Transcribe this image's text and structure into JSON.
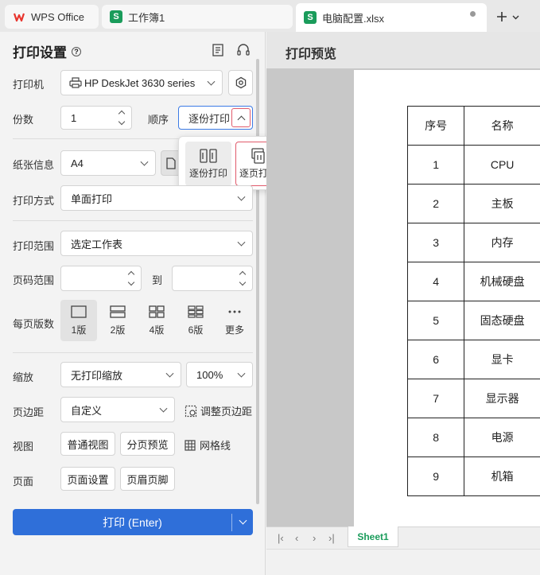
{
  "tabs": {
    "wps": "WPS Office",
    "book": "工作簿1",
    "file": "电脑配置.xlsx"
  },
  "panel": {
    "title": "打印设置",
    "printer_label": "打印机",
    "printer_value": "HP DeskJet 3630 series",
    "copies_label": "份数",
    "copies_value": "1",
    "order_label": "顺序",
    "order_value": "逐份打印",
    "order_options": [
      "逐份打印",
      "逐页打印"
    ],
    "paper_label": "纸张信息",
    "paper_value": "A4",
    "method_label": "打印方式",
    "method_value": "单面打印",
    "range_label": "打印范围",
    "range_value": "选定工作表",
    "pagerange_label": "页码范围",
    "pagerange_to": "到",
    "pps_label": "每页版数",
    "pps_options": [
      "1版",
      "2版",
      "4版",
      "6版",
      "更多"
    ],
    "scale_label": "缩放",
    "scale_value": "无打印缩放",
    "scale_percent": "100%",
    "margin_label": "页边距",
    "margin_value": "自定义",
    "margin_adjust": "调整页边距",
    "view_label": "视图",
    "view_normal": "普通视图",
    "view_pagebreak": "分页预览",
    "view_grid": "网格线",
    "page_label": "页面",
    "page_setup": "页面设置",
    "header_footer": "页眉页脚",
    "print_button": "打印 (Enter)"
  },
  "preview": {
    "title": "打印预览",
    "sheet_tab": "Sheet1",
    "table_rows": [
      [
        "序号",
        "名称"
      ],
      [
        "1",
        "CPU"
      ],
      [
        "2",
        "主板"
      ],
      [
        "3",
        "内存"
      ],
      [
        "4",
        "机械硬盘"
      ],
      [
        "5",
        "固态硬盘"
      ],
      [
        "6",
        "显卡"
      ],
      [
        "7",
        "显示器"
      ],
      [
        "8",
        "电源"
      ],
      [
        "9",
        "机箱"
      ]
    ]
  },
  "colors": {
    "accent": "#2f6fd9",
    "highlight": "#e05a6b",
    "sheet_green": "#1a9c5b"
  }
}
